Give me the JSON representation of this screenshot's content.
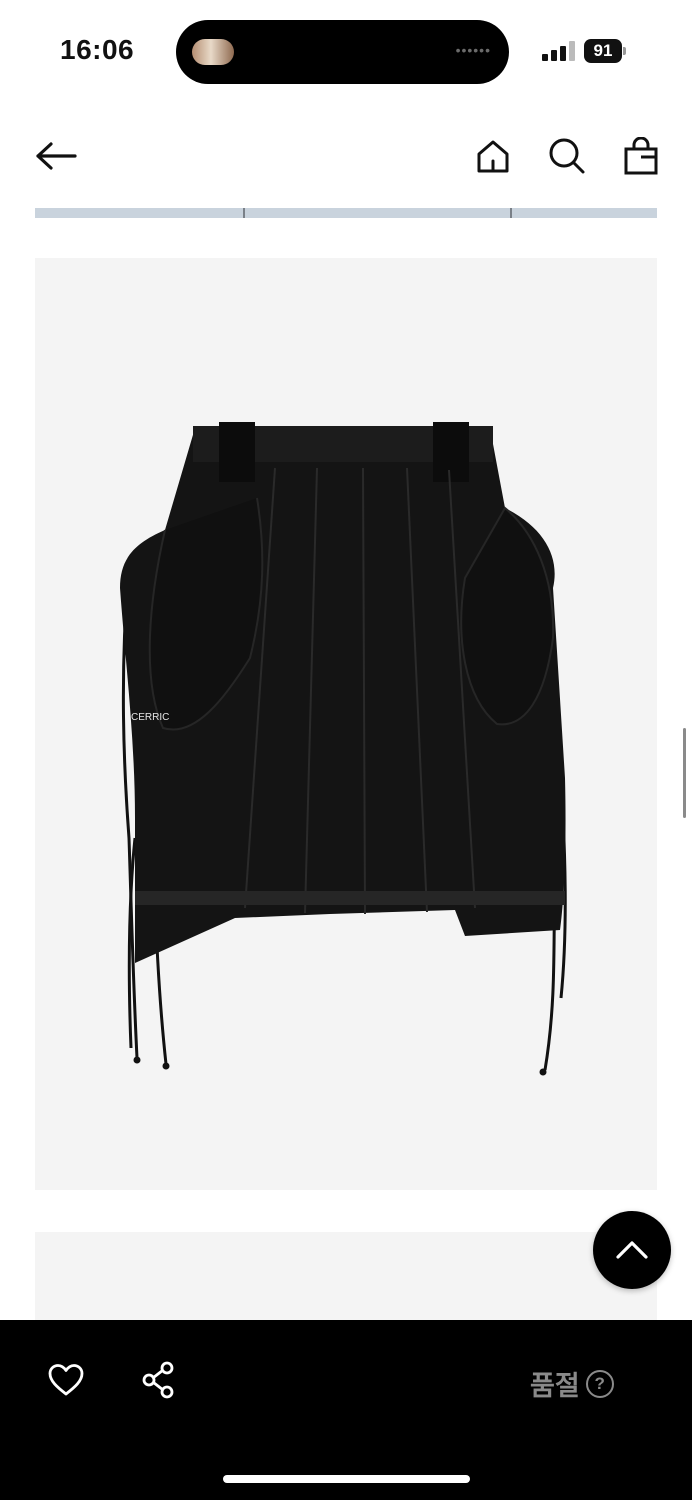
{
  "status_bar": {
    "time": "16:06",
    "battery": "91",
    "signal_icon": "cellular-signal-icon"
  },
  "nav": {
    "back_icon": "arrow-left-icon",
    "home_icon": "home-icon",
    "search_icon": "search-icon",
    "bag_icon": "shopping-bag-icon"
  },
  "product_image": {
    "logo_text": "CERRIC",
    "background": "#f4f4f4"
  },
  "bottom_bar": {
    "like_icon": "heart-icon",
    "share_icon": "share-icon",
    "soldout_label": "품절",
    "help_symbol": "?",
    "background": "#000000"
  },
  "scroll_top_icon": "chevron-up-icon"
}
